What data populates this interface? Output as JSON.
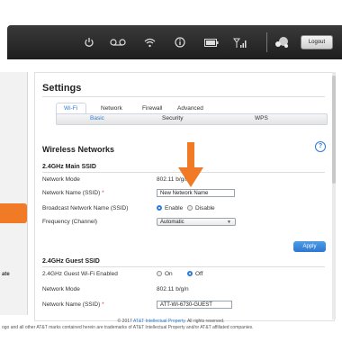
{
  "topbar": {
    "logout_label": "Logout"
  },
  "icons": [
    "power-icon",
    "voicemail-icon",
    "wifi-icon",
    "info-icon",
    "battery-icon",
    "signal-icon",
    "network-icon"
  ],
  "left": {
    "text": "ate"
  },
  "header": {
    "title": "Settings"
  },
  "tabs": [
    "Wi-Fi",
    "Network",
    "Firewall",
    "Advanced"
  ],
  "subtabs": [
    "Basic",
    "Security",
    "WPS"
  ],
  "wireless": {
    "title": "Wireless Networks",
    "help": "?",
    "main_ssid": {
      "title": "2.4GHz Main SSID",
      "network_mode_label": "Network Mode",
      "network_mode_value": "802.11 b/g/n",
      "name_label": "Network Name (SSID)",
      "name_value": "New Network Name",
      "broadcast_label": "Broadcast Network Name (SSID)",
      "enable": "Enable",
      "disable": "Disable",
      "frequency_label": "Frequency (Channel)",
      "frequency_value": "Automatic"
    },
    "apply_label": "Apply",
    "guest_ssid": {
      "title": "2.4GHz Guest SSID",
      "enabled_label": "2.4GHz Guest Wi-Fi Enabled",
      "on": "On",
      "off": "Off",
      "network_mode_label": "Network Mode",
      "network_mode_value": "802.11 b/g/n",
      "name_label": "Network Name (SSID)",
      "name_value": "ATT-WI-6730-GUEST"
    }
  },
  "footer": {
    "copyright_prefix": "© 2017",
    "copyright_link": "AT&T Intellectual Property",
    "copyright_suffix": ". All rights reserved.",
    "trademark": "ogo and all other AT&T marks contained herein are trademarks of AT&T Intellectual Property and/or AT&T affiliated companies."
  },
  "colors": {
    "accent": "#2d7bd6",
    "arrow": "#f07a26",
    "topbar": "#2a2a2a"
  }
}
